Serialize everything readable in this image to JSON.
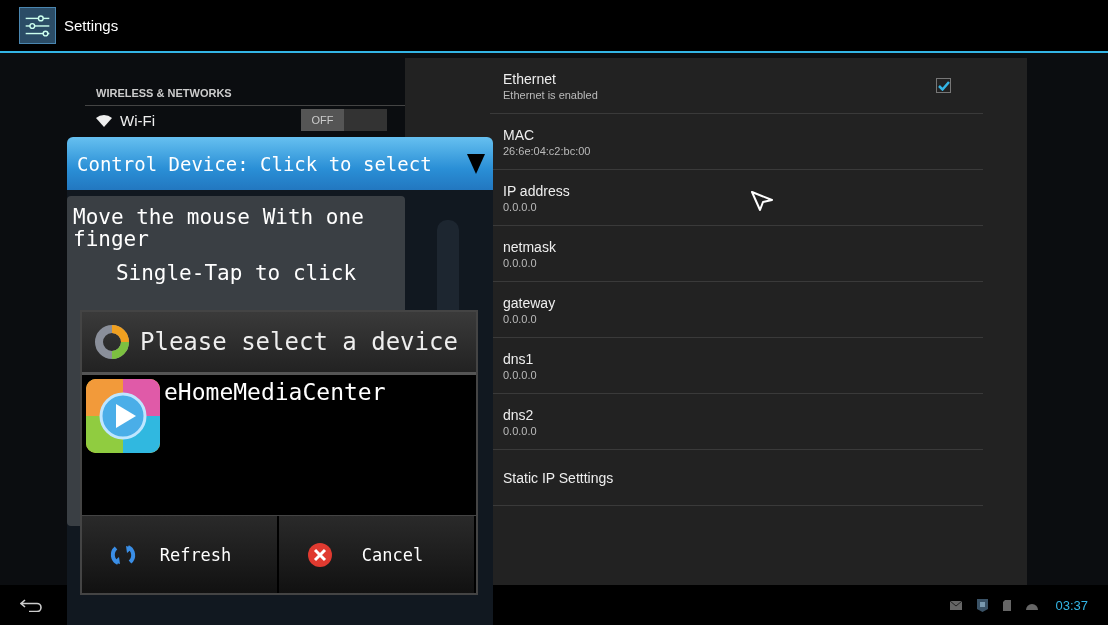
{
  "action_bar": {
    "title": "Settings"
  },
  "sidebar": {
    "header": "WIRELESS & NETWORKS",
    "items": [
      {
        "label": "Wi-Fi",
        "switch_label": "OFF",
        "on": false
      }
    ]
  },
  "ethernet": {
    "rows": [
      {
        "kind": "checkbox",
        "title": "Ethernet",
        "summary": "Ethernet is enabled",
        "checked": true
      },
      {
        "kind": "info",
        "title": "MAC",
        "summary": "26:6e:04:c2:bc:00"
      },
      {
        "kind": "info",
        "title": "IP address",
        "summary": "0.0.0.0"
      },
      {
        "kind": "info",
        "title": "netmask",
        "summary": "0.0.0.0"
      },
      {
        "kind": "info",
        "title": "gateway",
        "summary": "0.0.0.0"
      },
      {
        "kind": "info",
        "title": "dns1",
        "summary": "0.0.0.0"
      },
      {
        "kind": "info",
        "title": "dns2",
        "summary": "0.0.0.0"
      },
      {
        "kind": "link",
        "title": "Static IP Setttings"
      }
    ]
  },
  "overlay": {
    "control_bar": "Control Device: Click to select",
    "instructions": [
      "Move the mouse With one finger",
      "Single-Tap to click"
    ],
    "dialog": {
      "title": "Please select a device",
      "devices": [
        "eHomeMediaCenter"
      ],
      "buttons": [
        {
          "kind": "refresh",
          "label": "Refresh"
        },
        {
          "kind": "cancel",
          "label": "Cancel"
        }
      ]
    }
  },
  "status_bar": {
    "time": "03:37"
  }
}
